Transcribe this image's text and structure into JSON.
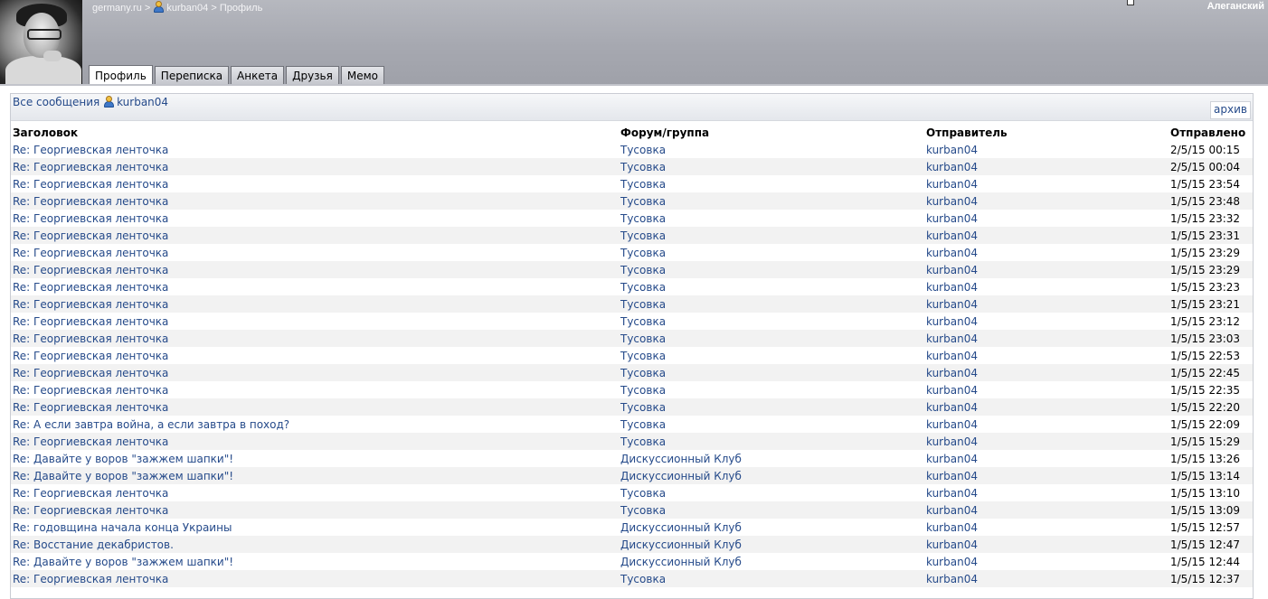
{
  "header": {
    "breadcrumb": {
      "site": "germany.ru",
      "sep": ">",
      "user": "kurban04",
      "page": "Профиль"
    },
    "username": "Алеганский"
  },
  "tabs": [
    {
      "label": "Профиль",
      "active": true
    },
    {
      "label": "Переписка",
      "active": false
    },
    {
      "label": "Анкета",
      "active": false
    },
    {
      "label": "Друзья",
      "active": false
    },
    {
      "label": "Мемо",
      "active": false
    }
  ],
  "panel": {
    "all_messages_label": "Все сообщения",
    "user": "kurban04",
    "archive_label": "архив"
  },
  "columns": [
    "Заголовок",
    "Форум/группа",
    "Отправитель",
    "Отправлено"
  ],
  "rows": [
    {
      "title": "Re: Георгиевская ленточка",
      "forum": "Тусовка",
      "sender": "kurban04",
      "date": "2/5/15 00:15"
    },
    {
      "title": "Re: Георгиевская ленточка",
      "forum": "Тусовка",
      "sender": "kurban04",
      "date": "2/5/15 00:04"
    },
    {
      "title": "Re: Георгиевская ленточка",
      "forum": "Тусовка",
      "sender": "kurban04",
      "date": "1/5/15 23:54"
    },
    {
      "title": "Re: Георгиевская ленточка",
      "forum": "Тусовка",
      "sender": "kurban04",
      "date": "1/5/15 23:48"
    },
    {
      "title": "Re: Георгиевская ленточка",
      "forum": "Тусовка",
      "sender": "kurban04",
      "date": "1/5/15 23:32"
    },
    {
      "title": "Re: Георгиевская ленточка",
      "forum": "Тусовка",
      "sender": "kurban04",
      "date": "1/5/15 23:31"
    },
    {
      "title": "Re: Георгиевская ленточка",
      "forum": "Тусовка",
      "sender": "kurban04",
      "date": "1/5/15 23:29"
    },
    {
      "title": "Re: Георгиевская ленточка",
      "forum": "Тусовка",
      "sender": "kurban04",
      "date": "1/5/15 23:29"
    },
    {
      "title": "Re: Георгиевская ленточка",
      "forum": "Тусовка",
      "sender": "kurban04",
      "date": "1/5/15 23:23"
    },
    {
      "title": "Re: Георгиевская ленточка",
      "forum": "Тусовка",
      "sender": "kurban04",
      "date": "1/5/15 23:21"
    },
    {
      "title": "Re: Георгиевская ленточка",
      "forum": "Тусовка",
      "sender": "kurban04",
      "date": "1/5/15 23:12"
    },
    {
      "title": "Re: Георгиевская ленточка",
      "forum": "Тусовка",
      "sender": "kurban04",
      "date": "1/5/15 23:03"
    },
    {
      "title": "Re: Георгиевская ленточка",
      "forum": "Тусовка",
      "sender": "kurban04",
      "date": "1/5/15 22:53"
    },
    {
      "title": "Re: Георгиевская ленточка",
      "forum": "Тусовка",
      "sender": "kurban04",
      "date": "1/5/15 22:45"
    },
    {
      "title": "Re: Георгиевская ленточка",
      "forum": "Тусовка",
      "sender": "kurban04",
      "date": "1/5/15 22:35"
    },
    {
      "title": "Re: Георгиевская ленточка",
      "forum": "Тусовка",
      "sender": "kurban04",
      "date": "1/5/15 22:20"
    },
    {
      "title": "Re: А если завтра война, а если завтра в поход?",
      "forum": "Тусовка",
      "sender": "kurban04",
      "date": "1/5/15 22:09"
    },
    {
      "title": "Re: Георгиевская ленточка",
      "forum": "Тусовка",
      "sender": "kurban04",
      "date": "1/5/15 15:29"
    },
    {
      "title": "Re: Давайте у воров \"зажжем шапки\"!",
      "forum": "Дискуссионный Клуб",
      "sender": "kurban04",
      "date": "1/5/15 13:26"
    },
    {
      "title": "Re: Давайте у воров \"зажжем шапки\"!",
      "forum": "Дискуссионный Клуб",
      "sender": "kurban04",
      "date": "1/5/15 13:14"
    },
    {
      "title": "Re: Георгиевская ленточка",
      "forum": "Тусовка",
      "sender": "kurban04",
      "date": "1/5/15 13:10"
    },
    {
      "title": "Re: Георгиевская ленточка",
      "forum": "Тусовка",
      "sender": "kurban04",
      "date": "1/5/15 13:09"
    },
    {
      "title": "Re: годовщина начала конца Украины",
      "forum": "Дискуссионный Клуб",
      "sender": "kurban04",
      "date": "1/5/15 12:57"
    },
    {
      "title": "Re: Восстание декабристов.",
      "forum": "Дискуссионный Клуб",
      "sender": "kurban04",
      "date": "1/5/15 12:47"
    },
    {
      "title": "Re: Давайте у воров \"зажжем шапки\"!",
      "forum": "Дискуссионный Клуб",
      "sender": "kurban04",
      "date": "1/5/15 12:44"
    },
    {
      "title": "Re: Георгиевская ленточка",
      "forum": "Тусовка",
      "sender": "kurban04",
      "date": "1/5/15 12:37"
    }
  ]
}
